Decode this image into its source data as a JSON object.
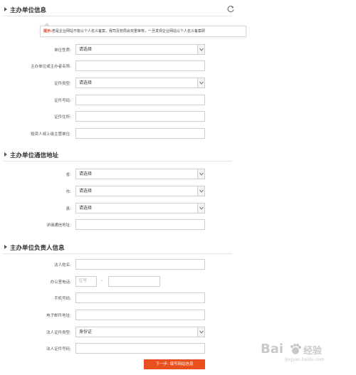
{
  "section1": {
    "title": "主办单位信息",
    "tip_label": "提示:",
    "tip_text": "若是企业网站不能以个人名义备案，我司及管局会双重审核，一旦发现企业网站以个人名义备案即",
    "rows": [
      {
        "label": "单位性质:",
        "type": "select",
        "value": "请选择"
      },
      {
        "label": "主办单位或主办者名称:",
        "type": "input",
        "value": ""
      },
      {
        "label": "证件类型:",
        "type": "select",
        "value": "请选择"
      },
      {
        "label": "证件号码:",
        "type": "input",
        "value": ""
      },
      {
        "label": "证件住所:",
        "type": "input",
        "value": ""
      },
      {
        "label": "投资人或上级主管单位:",
        "type": "input",
        "value": ""
      }
    ]
  },
  "section2": {
    "title": "主办单位通信地址",
    "rows": [
      {
        "label": "省:",
        "type": "select",
        "value": "请选择"
      },
      {
        "label": "市:",
        "type": "select",
        "value": "请选择"
      },
      {
        "label": "县:",
        "type": "select",
        "value": "请选择"
      },
      {
        "label": "详细通信地址:",
        "type": "input",
        "value": ""
      }
    ]
  },
  "section3": {
    "title": "主办单位负责人信息",
    "rows": [
      {
        "label": "法人姓名:",
        "type": "input",
        "value": ""
      },
      {
        "label": "办公室电话:",
        "type": "phone",
        "area_placeholder": "区号",
        "separator": "-",
        "value": ""
      },
      {
        "label": "手机号码:",
        "type": "input",
        "value": ""
      },
      {
        "label": "电子邮件地址:",
        "type": "input",
        "value": ""
      },
      {
        "label": "法人证件类型:",
        "type": "select",
        "value": "身份证"
      },
      {
        "label": "法人证件号码:",
        "type": "input",
        "value": ""
      }
    ]
  },
  "next_button": "下一步: 填写网站信息",
  "watermark": {
    "brand": "Bai",
    "brand2": "经验",
    "url": "jingyan.baidu.com"
  },
  "colors": {
    "accent": "#e8501d",
    "tip_label": "#e03a1c",
    "border": "#cfcfcf"
  },
  "icons": {
    "section": "triangle-arrow-icon",
    "refresh": "refresh-icon",
    "dropdown": "chevron-down-icon"
  }
}
